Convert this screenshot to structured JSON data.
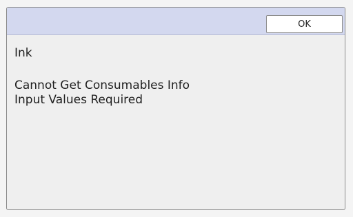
{
  "dialog": {
    "ok_label": "OK",
    "category": "Ink",
    "messages": [
      "Cannot Get Consumables Info",
      "Input Values Required"
    ]
  },
  "colors": {
    "titlebar": "#d3d8ef",
    "dialog_bg": "#efefef",
    "border": "#8a8a8a"
  }
}
